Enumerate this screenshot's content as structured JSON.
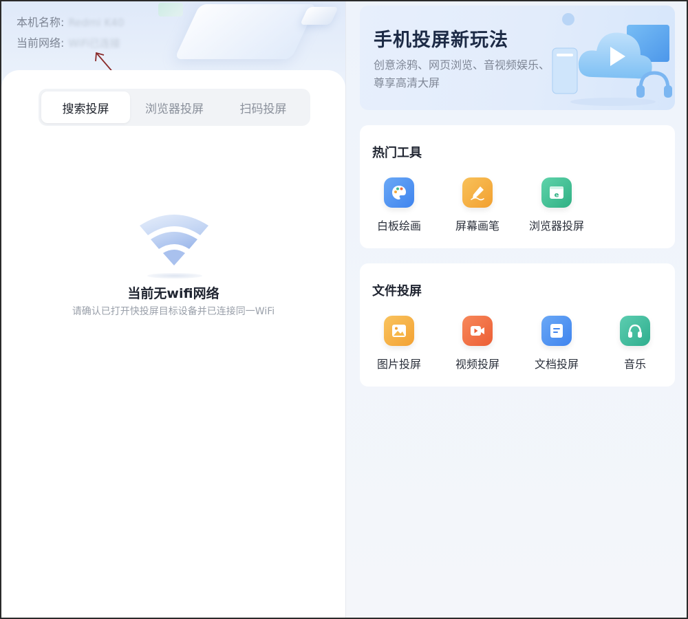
{
  "device": {
    "name_label": "本机名称:",
    "name_value": "Redmi K40",
    "network_label": "当前网络:",
    "network_value": "WiFi已连接"
  },
  "tabs": [
    {
      "label": "搜索投屏",
      "active": true
    },
    {
      "label": "浏览器投屏",
      "active": false
    },
    {
      "label": "扫码投屏",
      "active": false
    }
  ],
  "empty_state": {
    "title": "当前无wifi网络",
    "subtitle": "请确认已打开快投屏目标设备并已连接同一WiFi"
  },
  "banner": {
    "title": "手机投屏新玩法",
    "description": "创意涂鸦、网页浏览、音视频娱乐、尊享高清大屏"
  },
  "hot_tools": {
    "title": "热门工具",
    "items": [
      {
        "label": "白板绘画",
        "icon": "palette-icon",
        "color": "#4a8df0"
      },
      {
        "label": "屏幕画笔",
        "icon": "pen-icon",
        "color": "#f3a93a"
      },
      {
        "label": "浏览器投屏",
        "icon": "browser-icon",
        "color": "#3dbd92"
      }
    ]
  },
  "file_cast": {
    "title": "文件投屏",
    "items": [
      {
        "label": "图片投屏",
        "icon": "image-icon",
        "color": "#f5a93d"
      },
      {
        "label": "视频投屏",
        "icon": "video-icon",
        "color": "#f0703f"
      },
      {
        "label": "文档投屏",
        "icon": "document-icon",
        "color": "#4a8df0"
      },
      {
        "label": "音乐",
        "icon": "headphones-icon",
        "color": "#3db99a"
      }
    ]
  }
}
